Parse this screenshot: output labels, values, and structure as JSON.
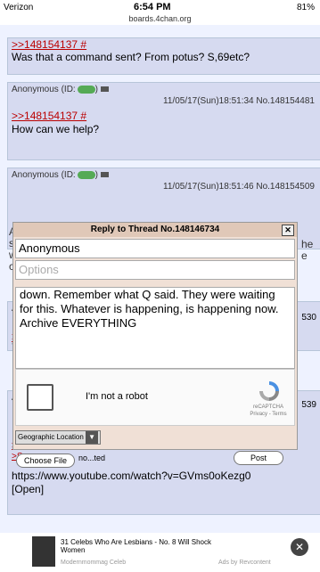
{
  "status": {
    "carrier": "Verizon",
    "time": "6:54 PM",
    "battery": "81%",
    "url": "boards.4chan.org"
  },
  "posts": [
    {
      "quote": ">>148154137 #",
      "text": "Was that a command sent? From potus? S,69etc?"
    },
    {
      "name": "Anonymous",
      "id_label": "(ID:",
      "meta": "11/05/17(Sun)18:51:34 No.148154481",
      "quote": ">>148154137 #",
      "text": "How can we help?"
    },
    {
      "name": "Anonymous",
      "id_label": "(ID:",
      "meta": "11/05/17(Sun)18:51:46 No.148154509",
      "text_fragments": [
        "Alr",
        "sei",
        "wo",
        "co"
      ],
      "right_fragments": [
        "he",
        "e"
      ]
    },
    {
      "prefix": "A",
      "right": "530",
      "quote": ">>",
      "text": "Yo"
    },
    {
      "prefix": "A",
      "right": "539",
      "quote": ">>",
      "text_fragment": ">S",
      "link": "https://www.youtube.com/watch?v=GVms0oKezg0",
      "open": "[Open]"
    }
  ],
  "modal": {
    "title": "Reply to Thread No.148146734",
    "close": "✕",
    "name_value": "Anonymous",
    "options_placeholder": "Options",
    "comment": "down. Remember what Q said. They were waiting for this. Whatever is happening, is happening now. Archive EVERYTHING",
    "captcha_label": "I'm not a robot",
    "captcha_brand": "reCAPTCHA",
    "captcha_privacy": "Privacy - Terms",
    "geo_label": "Geographic Location",
    "choose_file": "Choose File",
    "file_status": "no...ted",
    "post_button": "Post"
  },
  "ad": {
    "title": "31 Celebs Who Are Lesbians - No. 8 Will Shock Women",
    "source": "Modernmommag Celeb",
    "by": "Ads by Revcontent"
  }
}
